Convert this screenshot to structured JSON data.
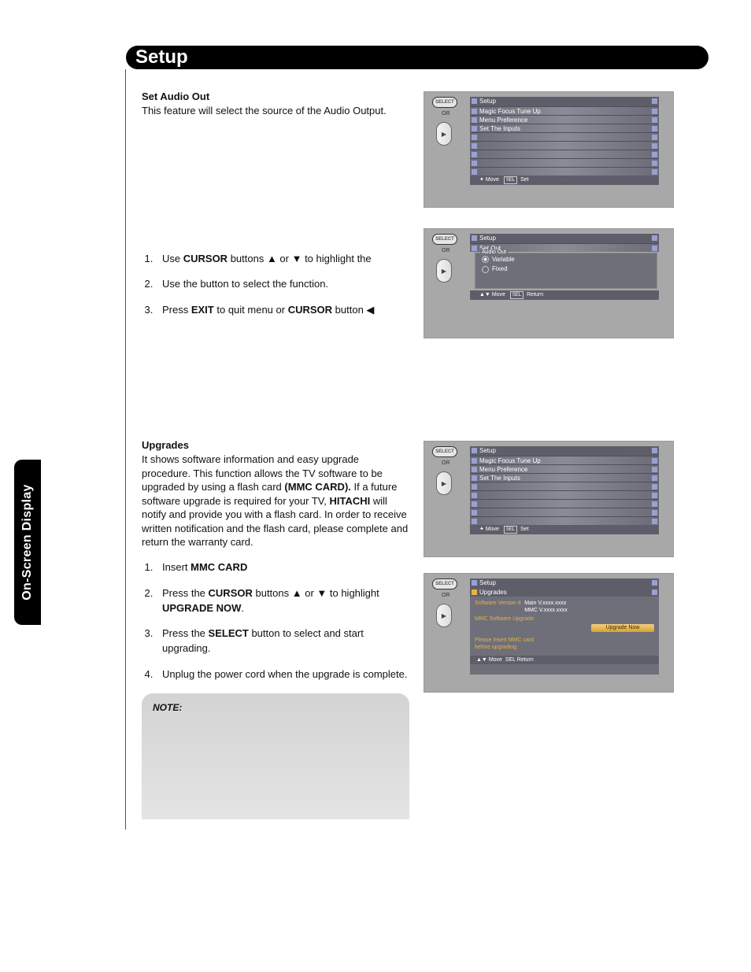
{
  "page_title": "Setup",
  "side_tab": "On-Screen Display",
  "section1": {
    "heading": "Set Audio Out",
    "intro": "This feature will select the source of the Audio Output.",
    "step1_a": "Use ",
    "step1_b": "CURSOR",
    "step1_c": " buttons ▲ or ▼ to highlight the",
    "step2_a": "Use the ",
    "step2_b": " button to select the function.",
    "step3_a": "Press ",
    "step3_b": "EXIT",
    "step3_c": " to quit menu or ",
    "step3_d": "CURSOR",
    "step3_e": " button ◀"
  },
  "section2": {
    "heading": "Upgrades",
    "intro_a": "It shows software information and easy upgrade procedure. This function allows the TV software to be upgraded by using a flash card ",
    "intro_b": "(MMC CARD).",
    "intro_c": " If a future software upgrade is required for your TV, ",
    "intro_d": "HITACHI",
    "intro_e": " will notify and provide you with a flash card. In order to receive written notification and the flash card, please complete and return the warranty card.",
    "step1_a": "Insert ",
    "step1_b": "MMC CARD",
    "step2_a": "Press the ",
    "step2_b": "CURSOR",
    "step2_c": " buttons ▲ or ▼ to highlight ",
    "step2_d": "UPGRADE NOW",
    "step2_e": ".",
    "step3_a": "Press the ",
    "step3_b": "SELECT",
    "step3_c": " button to select and start upgrading.",
    "step4": "Unplug the power cord when the upgrade is complete."
  },
  "note_label": "NOTE:",
  "remote": {
    "select": "SELECT",
    "or": "OR"
  },
  "menu_setup": {
    "title": "Setup",
    "items": [
      "Magic Focus Tune Up",
      "Menu Preference",
      "Set The Inputs",
      "",
      "",
      "",
      "",
      ""
    ],
    "foot_move": "Move",
    "foot_set": "Set",
    "foot_sel": "SEL"
  },
  "menu_audio": {
    "title": "Setup",
    "sub": "Set          Out",
    "group": "Audio Out",
    "opt1": "Variable",
    "opt2": "Fixed",
    "foot_move": "Move",
    "foot_ret": "Return",
    "foot_sel": "SEL"
  },
  "menu_upg": {
    "title": "Setup",
    "sub": "Upgrades",
    "sw_label": "Software Version #",
    "sw_main": "Main V.xxxx.xxxx",
    "sw_mmc": "MMC V.xxxx.xxxx",
    "mmc_label": "MMC Software Upgrade",
    "btn": "Upgrade Now",
    "note1": "Please Insert MMC card",
    "note2": "before upgrading.",
    "foot_move": "Move",
    "foot_sel": "SEL",
    "foot_ret": "Return"
  }
}
